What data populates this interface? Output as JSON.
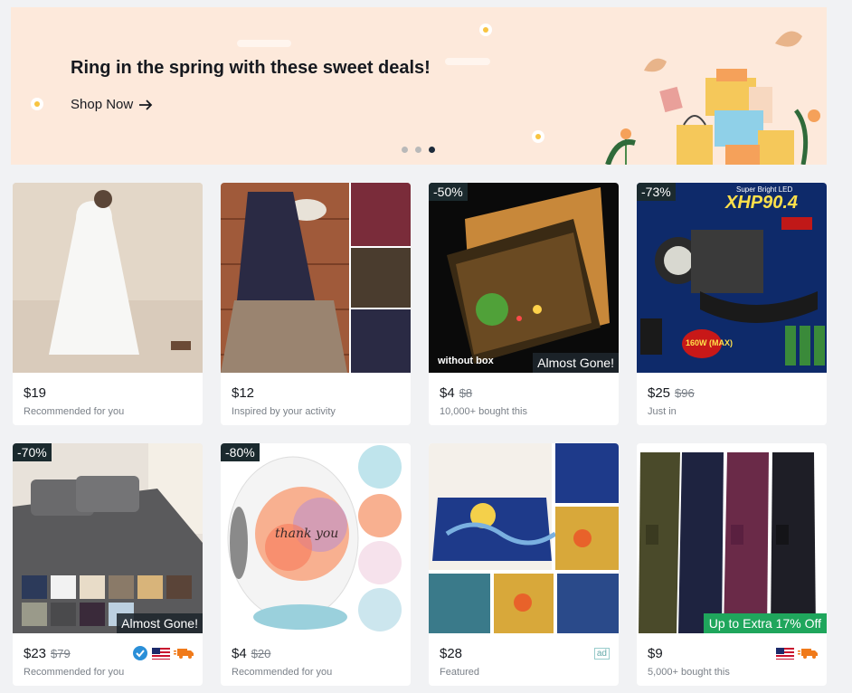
{
  "banner": {
    "headline": "Ring in the spring with these sweet deals!",
    "cta_label": "Shop Now",
    "cta_icon": "arrow-right-icon",
    "slides": 3,
    "active_slide": 3
  },
  "colors": {
    "banner_bg": "#fde9db",
    "discount_badge": "#1b2a2e",
    "green_badge": "#1fa65c",
    "page_bg": "#f1f2f4"
  },
  "products": [
    {
      "price": "$19",
      "original": "",
      "subtitle": "Recommended for you",
      "discount": "",
      "overlay": "",
      "image": "white-linen-dress"
    },
    {
      "price": "$12",
      "original": "",
      "subtitle": "Inspired by your activity",
      "discount": "",
      "overlay": "",
      "image": "floral-patchwork-dress"
    },
    {
      "price": "$4",
      "original": "$8",
      "subtitle": "10,000+ bought this",
      "discount": "-50%",
      "overlay": "Almost Gone!",
      "image_text": "without box",
      "image": "glowing-rose-gift-box"
    },
    {
      "price": "$25",
      "original": "$96",
      "subtitle": "Just in",
      "discount": "-73%",
      "overlay": "",
      "image_text": "XHP90.4",
      "image_text2": "Super Bright LED",
      "image_text3": "160W (MAX)",
      "image": "led-headlamp"
    },
    {
      "price": "$23",
      "original": "$79",
      "subtitle": "Recommended for you",
      "discount": "-70%",
      "overlay": "Almost Gone!",
      "image": "grey-bed-sheets",
      "icons": [
        "verified-icon",
        "us-flag-icon",
        "fast-shipping-icon"
      ]
    },
    {
      "price": "$4",
      "original": "$20",
      "subtitle": "Recommended for you",
      "discount": "-80%",
      "overlay": "",
      "image_text": "thank you",
      "image": "thank-you-sticker-roll"
    },
    {
      "price": "$28",
      "original": "",
      "subtitle": "Featured",
      "discount": "",
      "overlay": "",
      "image": "starry-night-bedding",
      "ad_label": "ad"
    },
    {
      "price": "$9",
      "original": "",
      "subtitle": "5,000+ bought this",
      "discount": "",
      "overlay_green": "Up to Extra 17% Off",
      "image": "cargo-yoga-pants",
      "icons": [
        "us-flag-icon",
        "fast-shipping-icon"
      ]
    }
  ]
}
